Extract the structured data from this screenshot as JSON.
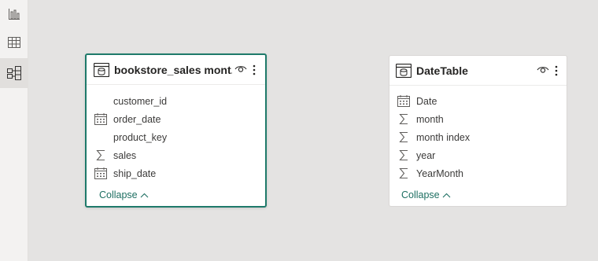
{
  "rail": {
    "items": [
      {
        "name": "report-view",
        "icon": "bar-chart-icon"
      },
      {
        "name": "data-view",
        "icon": "table-grid-icon"
      },
      {
        "name": "model-view",
        "icon": "model-diagram-icon",
        "active": true
      }
    ]
  },
  "tables": [
    {
      "title": "bookstore_sales mont...",
      "fields": [
        {
          "label": "customer_id",
          "icon": "none"
        },
        {
          "label": "order_date",
          "icon": "calendar-icon"
        },
        {
          "label": "product_key",
          "icon": "none"
        },
        {
          "label": "sales",
          "icon": "sigma-icon"
        },
        {
          "label": "ship_date",
          "icon": "calendar-icon"
        }
      ],
      "collapse_label": "Collapse"
    },
    {
      "title": "DateTable",
      "fields": [
        {
          "label": "Date",
          "icon": "calendar-icon"
        },
        {
          "label": "month",
          "icon": "sigma-icon"
        },
        {
          "label": "month index",
          "icon": "sigma-icon"
        },
        {
          "label": "year",
          "icon": "sigma-icon"
        },
        {
          "label": "YearMonth",
          "icon": "sigma-icon"
        }
      ],
      "collapse_label": "Collapse"
    }
  ],
  "colors": {
    "canvas": "#e4e3e2",
    "selected_border": "#1e7a6a",
    "link": "#1e6f62"
  }
}
